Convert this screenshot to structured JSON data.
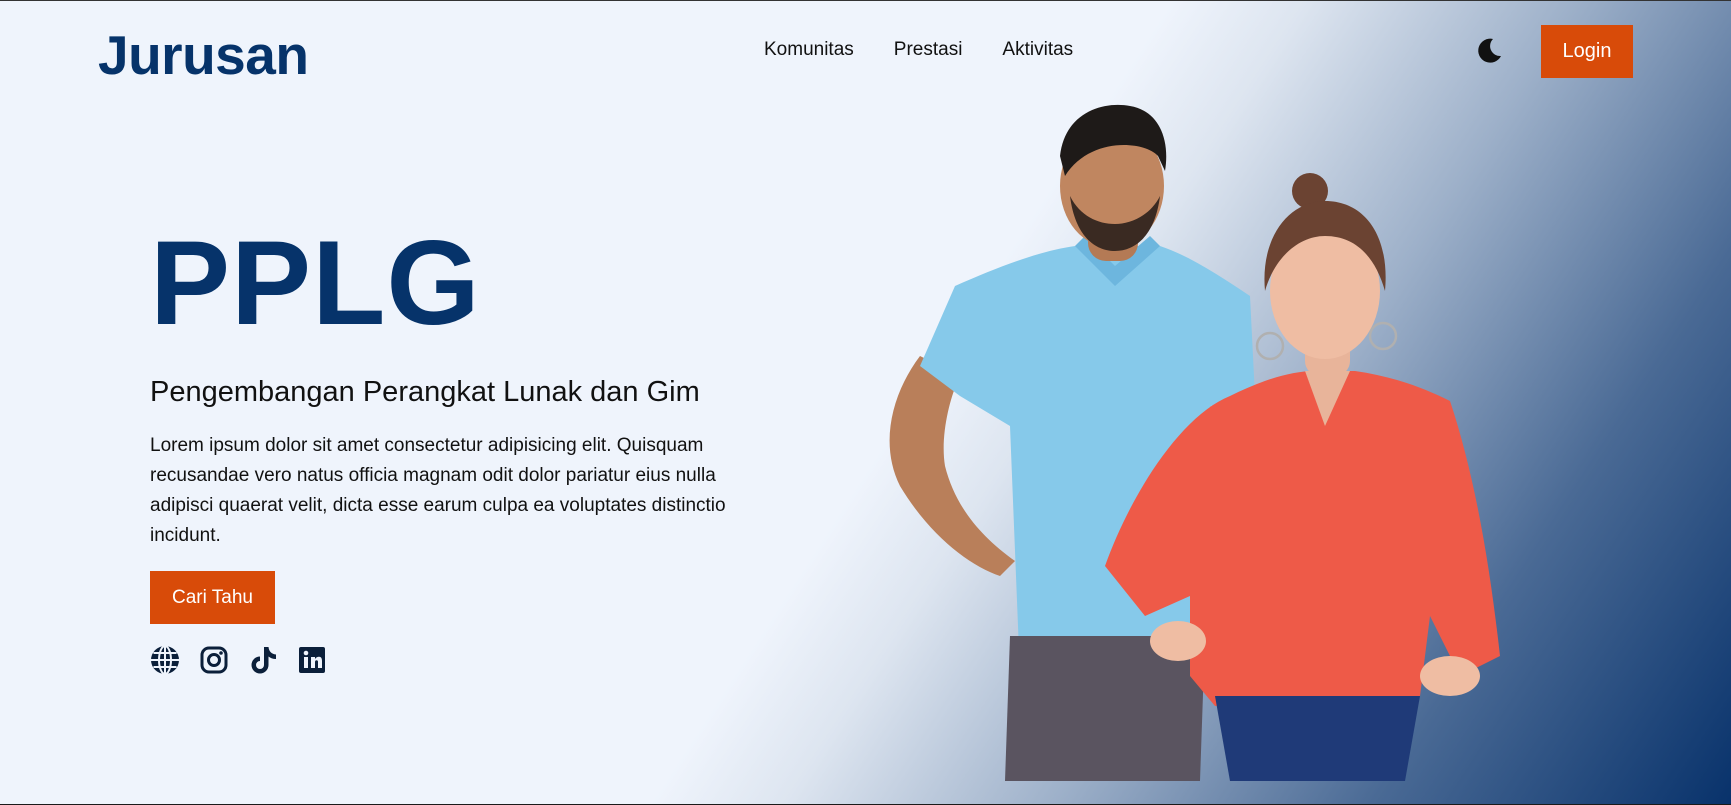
{
  "header": {
    "brand": "Jurusan",
    "nav": [
      "Komunitas",
      "Prestasi",
      "Aktivitas"
    ],
    "theme_toggle_icon": "moon-icon",
    "login_label": "Login"
  },
  "hero": {
    "title": "PPLG",
    "subtitle": "Pengembangan Perangkat Lunak dan Gim",
    "description": "Lorem ipsum dolor sit amet consectetur adipisicing elit. Quisquam recusandae vero natus officia magnam odit dolor pariatur eius nulla adipisci quaerat velit, dicta esse earum culpa ea voluptates distinctio incidunt.",
    "cta_label": "Cari Tahu",
    "socials": [
      "globe-icon",
      "instagram-icon",
      "tiktok-icon",
      "linkedin-icon"
    ]
  },
  "colors": {
    "brand": "#06336a",
    "accent": "#d84b09",
    "background": "#eff4fc"
  }
}
